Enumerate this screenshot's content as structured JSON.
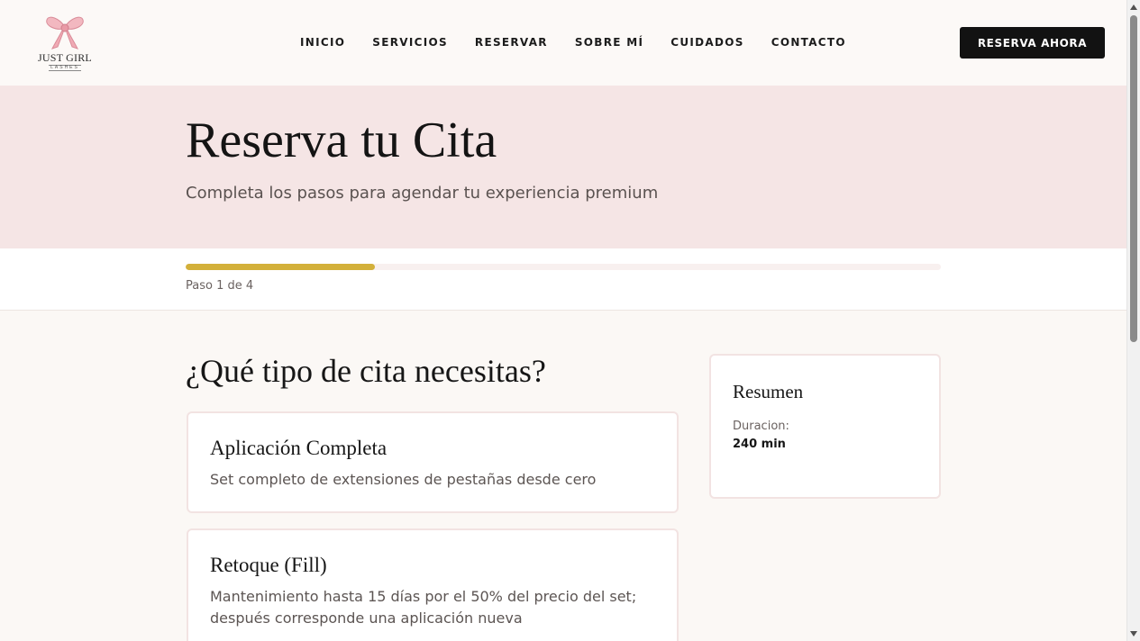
{
  "brand": {
    "name": "JUST GIRL",
    "tagline": "LASHES"
  },
  "nav": {
    "items": [
      {
        "label": "INICIO"
      },
      {
        "label": "SERVICIOS"
      },
      {
        "label": "RESERVAR"
      },
      {
        "label": "SOBRE MÍ"
      },
      {
        "label": "CUIDADOS"
      },
      {
        "label": "CONTACTO"
      }
    ],
    "cta_label": "RESERVA AHORA"
  },
  "hero": {
    "title": "Reserva tu Cita",
    "subtitle": "Completa los pasos para agendar tu experiencia premium"
  },
  "progress": {
    "label": "Paso 1 de 4",
    "current_step": 1,
    "total_steps": 4,
    "fraction": 0.25,
    "color": "#d3b03a"
  },
  "step": {
    "question": "¿Qué tipo de cita necesitas?",
    "options": [
      {
        "title": "Aplicación Completa",
        "description": "Set completo de extensiones de pestañas desde cero"
      },
      {
        "title": "Retoque (Fill)",
        "description": "Mantenimiento hasta 15 días por el 50% del precio del set; después corresponde una aplicación nueva"
      }
    ]
  },
  "summary": {
    "title": "Resumen",
    "duration_label": "Duracion:",
    "duration_value": "240 min"
  },
  "colors": {
    "accent": "#d3b03a",
    "hero_bg": "#f5e5e5",
    "page_bg": "#fbf8f5",
    "cta_bg": "#121212",
    "card_border": "#f2e3e2"
  },
  "icons": {
    "logo": "pink-bow-icon"
  }
}
